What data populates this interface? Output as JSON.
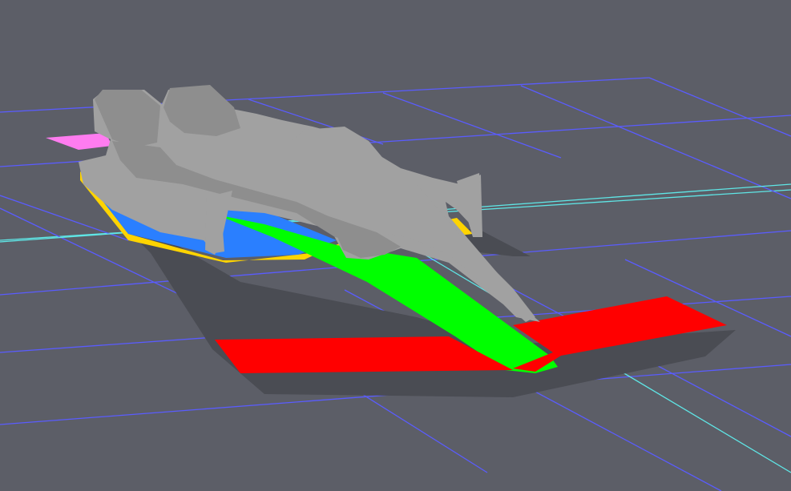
{
  "viewport": {
    "background_color": "#5c5e67",
    "grid_color": "#5a5cff",
    "axis_color": "#5fe6e6",
    "shadow_color": "#4a4c53"
  },
  "model": {
    "body_color": "#a1a1a1",
    "body_shade_color": "#8e8e8e",
    "floor_edge_color": "#ffd400",
    "floor_color": "#2a7fff",
    "sidepod_underside_color": "#38f5ea",
    "floor_strip_color": "#00ff00",
    "front_wing_color": "#ff0000",
    "rear_wing_endplate_color": "#ff7cf0"
  }
}
